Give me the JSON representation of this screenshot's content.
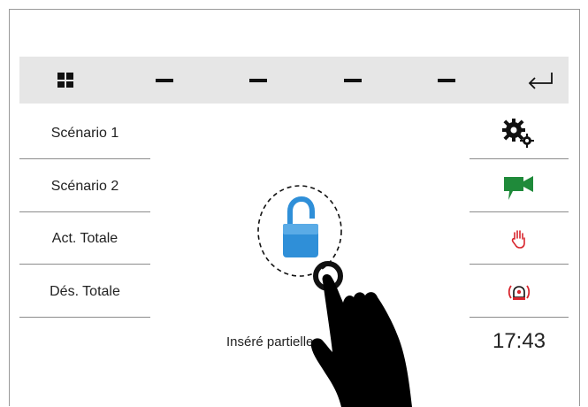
{
  "toolbar": {
    "items": [
      {
        "name": "grid-icon"
      },
      {
        "name": "dash-icon"
      },
      {
        "name": "dash-icon"
      },
      {
        "name": "dash-icon"
      },
      {
        "name": "dash-icon"
      },
      {
        "name": "return-arrow-icon"
      }
    ]
  },
  "menu": {
    "items": [
      {
        "label": "Scénario 1"
      },
      {
        "label": "Scénario 2"
      },
      {
        "label": "Act. Totale"
      },
      {
        "label": "Dés. Totale"
      }
    ]
  },
  "right_panel": {
    "icons": [
      "gears-icon",
      "video-camera-icon",
      "hand-stop-icon",
      "alarm-siren-icon"
    ]
  },
  "main": {
    "lock_icon": "padlock-open-icon",
    "status_text": "Inséré partielle"
  },
  "clock": {
    "time": "17:43"
  },
  "colors": {
    "toolbar_bg": "#e6e6e6",
    "lock_blue": "#2f8fd8",
    "camera_green": "#1f8a3a",
    "alert_red": "#d8262e"
  }
}
